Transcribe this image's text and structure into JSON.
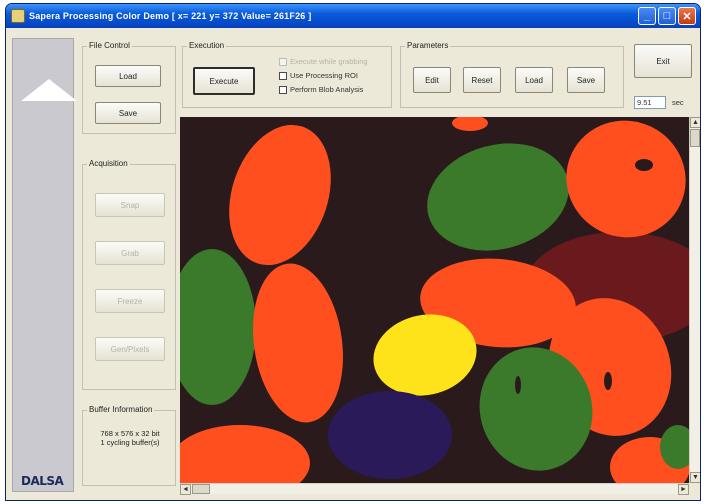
{
  "window": {
    "title": "Sapera Processing Color Demo  [ x= 221 y= 372 Value= 261F26 ]",
    "minimize": "_",
    "maximize": "□",
    "close": "✕"
  },
  "logo": "DALSA",
  "file_control": {
    "label": "File Control",
    "load": "Load",
    "save": "Save"
  },
  "acquisition": {
    "label": "Acquisition",
    "snap": "Snap",
    "grab": "Grab",
    "freeze": "Freeze",
    "general": "Gen/Pixels"
  },
  "buffer_info": {
    "label": "Buffer Information",
    "line1": "768 x 576 x 32 bit",
    "line2": "1 cycling buffer(s)"
  },
  "execution": {
    "label": "Execution",
    "execute": "Execute",
    "checkboxes": [
      {
        "label": "Execute while grabbing",
        "enabled": false
      },
      {
        "label": "Use Processing ROI",
        "enabled": true
      },
      {
        "label": "Perform Blob Analysis",
        "enabled": true
      }
    ]
  },
  "parameters": {
    "label": "Parameters",
    "edit": "Edit",
    "reset": "Reset",
    "load": "Load",
    "save": "Save"
  },
  "exit": "Exit",
  "timer": {
    "value": "9.51",
    "unit": "sec"
  },
  "scroll": {
    "up": "▲",
    "down": "▼",
    "left": "◄",
    "right": "►"
  },
  "colors": {
    "orange": "#ff4f1f",
    "green": "#3a7a2a",
    "maroon": "#6a1a1c",
    "yellow": "#ffe31a",
    "navy": "#2a1a5a",
    "background": "#2a1a1c"
  }
}
